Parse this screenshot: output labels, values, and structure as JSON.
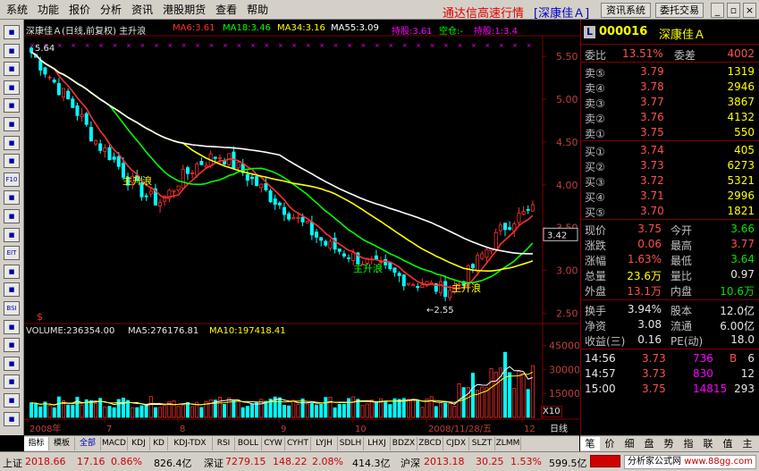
{
  "menubar": {
    "items": [
      "系统",
      "功能",
      "报价",
      "分析",
      "资讯",
      "港股期货",
      "查看",
      "帮助"
    ],
    "app_title": "通达信高速行情",
    "stock_bracket": "[深康佳Ａ]",
    "buttons": [
      "资讯系统",
      "委托交易"
    ]
  },
  "left_toolbar": {
    "icons": [
      "grid-icon",
      "line-chart-icon",
      "table-icon",
      "bar-chart-icon",
      "list-icon",
      "tick-icon",
      "notes-icon",
      "search-icon",
      "F10",
      "info-icon",
      "text-icon",
      "layout-icon",
      "EIT",
      "chart-icon",
      "window-icon",
      "BSI",
      "pen-icon",
      "link-icon",
      "dollar-icon",
      "tools-icon",
      "web-icon",
      "flag-icon"
    ]
  },
  "chart": {
    "header_name": "深康佳Ａ(日线,前复权) 主升浪",
    "ma_legends": [
      {
        "text": "MA6:3.61",
        "color": "#ff3030"
      },
      {
        "text": "MA18:3.46",
        "color": "#00ff00"
      },
      {
        "text": "MA34:3.16",
        "color": "#ffff00"
      },
      {
        "text": "MA55:3.09",
        "color": "#ffffff"
      }
    ],
    "signal_texts": [
      {
        "text": "持股:3.61",
        "color": "#ff00ff"
      },
      {
        "text": "空仓:-",
        "color": "#00ff00"
      },
      {
        "text": "持股:1:3.4",
        "color": "#ff00ff"
      }
    ],
    "price_ticks": [
      "5.50",
      "5.00",
      "4.50",
      "4.00",
      "3.50",
      "3.00",
      "2.50"
    ],
    "current_price_tag": "3.42",
    "high_label": "5.64",
    "low_label": "←2.55",
    "annotations": [
      "主升浪",
      "主升浪",
      "主升浪"
    ],
    "volume_legend": {
      "volume": "VOLUME:236354.00",
      "ma5": "MA5:276176.81",
      "ma10": "MA10:197418.41"
    },
    "volume_ticks": [
      "45000",
      "30000",
      "15000"
    ],
    "volume_unit": "X10",
    "x_axis_labels": [
      "2008年",
      "7",
      "8",
      "9",
      "10",
      "2008/11/28/五",
      "12"
    ],
    "period_label": "日线",
    "colors": {
      "up": "#ff3030",
      "down": "#00ffff",
      "ma6": "#ff3030",
      "ma18": "#00ff00",
      "ma34": "#ffff00",
      "ma55": "#ffffff"
    }
  },
  "chart_data": {
    "type": "candlestick",
    "title": "深康佳Ａ(日线,前复权) 主升浪",
    "ylim": [
      2.4,
      5.7
    ],
    "ma_last": {
      "MA6": 3.61,
      "MA18": 3.46,
      "MA34": 3.16,
      "MA55": 3.09
    },
    "high": 5.64,
    "low": 2.55,
    "close_points": [
      5.55,
      5.4,
      5.25,
      5.1,
      4.95,
      4.8,
      4.6,
      4.45,
      4.35,
      4.2,
      4.05,
      3.95,
      3.85,
      3.8,
      3.9,
      4.05,
      4.15,
      4.25,
      4.3,
      4.35,
      4.3,
      4.2,
      4.1,
      4.0,
      3.9,
      3.8,
      3.7,
      3.6,
      3.5,
      3.4,
      3.3,
      3.25,
      3.2,
      3.15,
      3.1,
      3.05,
      3.0,
      2.95,
      2.9,
      2.85,
      2.85,
      2.8,
      2.78,
      2.8,
      2.9,
      3.05,
      3.2,
      3.35,
      3.5,
      3.6,
      3.65,
      3.7
    ],
    "volume_ticks": [
      45000,
      30000,
      15000
    ],
    "volume_last": 236354.0
  },
  "quote": {
    "code": "000016",
    "name": "深康佳Ａ",
    "wb_label": "委比",
    "wb_value": "13.51%",
    "wc_label": "委差",
    "wc_value": "4002",
    "sells": [
      {
        "label": "卖⑤",
        "price": "3.79",
        "vol": "1319"
      },
      {
        "label": "卖④",
        "price": "3.78",
        "vol": "2946"
      },
      {
        "label": "卖③",
        "price": "3.77",
        "vol": "3867"
      },
      {
        "label": "卖②",
        "price": "3.76",
        "vol": "4132"
      },
      {
        "label": "卖①",
        "price": "3.75",
        "vol": "550"
      }
    ],
    "buys": [
      {
        "label": "买①",
        "price": "3.74",
        "vol": "405"
      },
      {
        "label": "买②",
        "price": "3.73",
        "vol": "6273"
      },
      {
        "label": "买③",
        "price": "3.72",
        "vol": "5321"
      },
      {
        "label": "买④",
        "price": "3.71",
        "vol": "2996"
      },
      {
        "label": "买⑤",
        "price": "3.70",
        "vol": "1821"
      }
    ],
    "stats": [
      {
        "l1": "现价",
        "v1": "3.75",
        "c1": "c-red",
        "l2": "今开",
        "v2": "3.66",
        "c2": "c-green"
      },
      {
        "l1": "涨跌",
        "v1": "0.06",
        "c1": "c-red",
        "l2": "最高",
        "v2": "3.77",
        "c2": "c-red"
      },
      {
        "l1": "涨幅",
        "v1": "1.63%",
        "c1": "c-red",
        "l2": "最低",
        "v2": "3.64",
        "c2": "c-green"
      },
      {
        "l1": "总量",
        "v1": "23.6万",
        "c1": "c-yellow",
        "l2": "量比",
        "v2": "0.97",
        "c2": "c-white"
      },
      {
        "l1": "外盘",
        "v1": "13.1万",
        "c1": "c-red",
        "l2": "内盘",
        "v2": "10.6万",
        "c2": "c-green"
      }
    ],
    "fundamentals": [
      {
        "l1": "换手",
        "v1": "3.94%",
        "l2": "股本",
        "v2": "12.0亿"
      },
      {
        "l1": "净资",
        "v1": "3.08",
        "l2": "流通",
        "v2": "6.00亿"
      },
      {
        "l1": "收益(三)",
        "v1": "0.16",
        "l2": "PE(动)",
        "v2": "18.0"
      }
    ],
    "ticks": [
      {
        "time": "14:56",
        "price": "3.73",
        "vol": "736",
        "side": "B",
        "num": "6"
      },
      {
        "time": "14:57",
        "price": "3.73",
        "vol": "830",
        "side": "",
        "num": "12"
      },
      {
        "time": "15:00",
        "price": "3.75",
        "vol": "14815",
        "side": "",
        "num": "293"
      }
    ]
  },
  "bottom_tabs": [
    "指标",
    "模板",
    "全部",
    "MACD",
    "KDJ",
    "KD",
    "KDJ-TDX",
    "RSI",
    "BOLL",
    "CYW",
    "CYHT",
    "LYJH",
    "SDLH",
    "LHXJ",
    "BDZX",
    "ZBCD",
    "CJDX",
    "SLZT",
    "ZLMM"
  ],
  "right_tabs": [
    "笔",
    "价",
    "细",
    "盘",
    "势",
    "指",
    "联",
    "值",
    "主"
  ],
  "status": {
    "sh_label": "上证",
    "sh_value": "2018.66",
    "sh_change": "17.16",
    "sh_pct": "0.86%",
    "sh_amount": "826.4亿",
    "sz_label": "深证",
    "sz_value": "7279.15",
    "sz_change": "148.22",
    "sz_pct": "2.08%",
    "sz_amount": "414.3亿",
    "hs_label": "沪深",
    "hs_value": "2013.18",
    "hs_change": "30.25",
    "hs_pct": "1.53%",
    "hs_amount": "599.5亿",
    "brand": "分析家公式网",
    "website": "www.88gg.com"
  }
}
